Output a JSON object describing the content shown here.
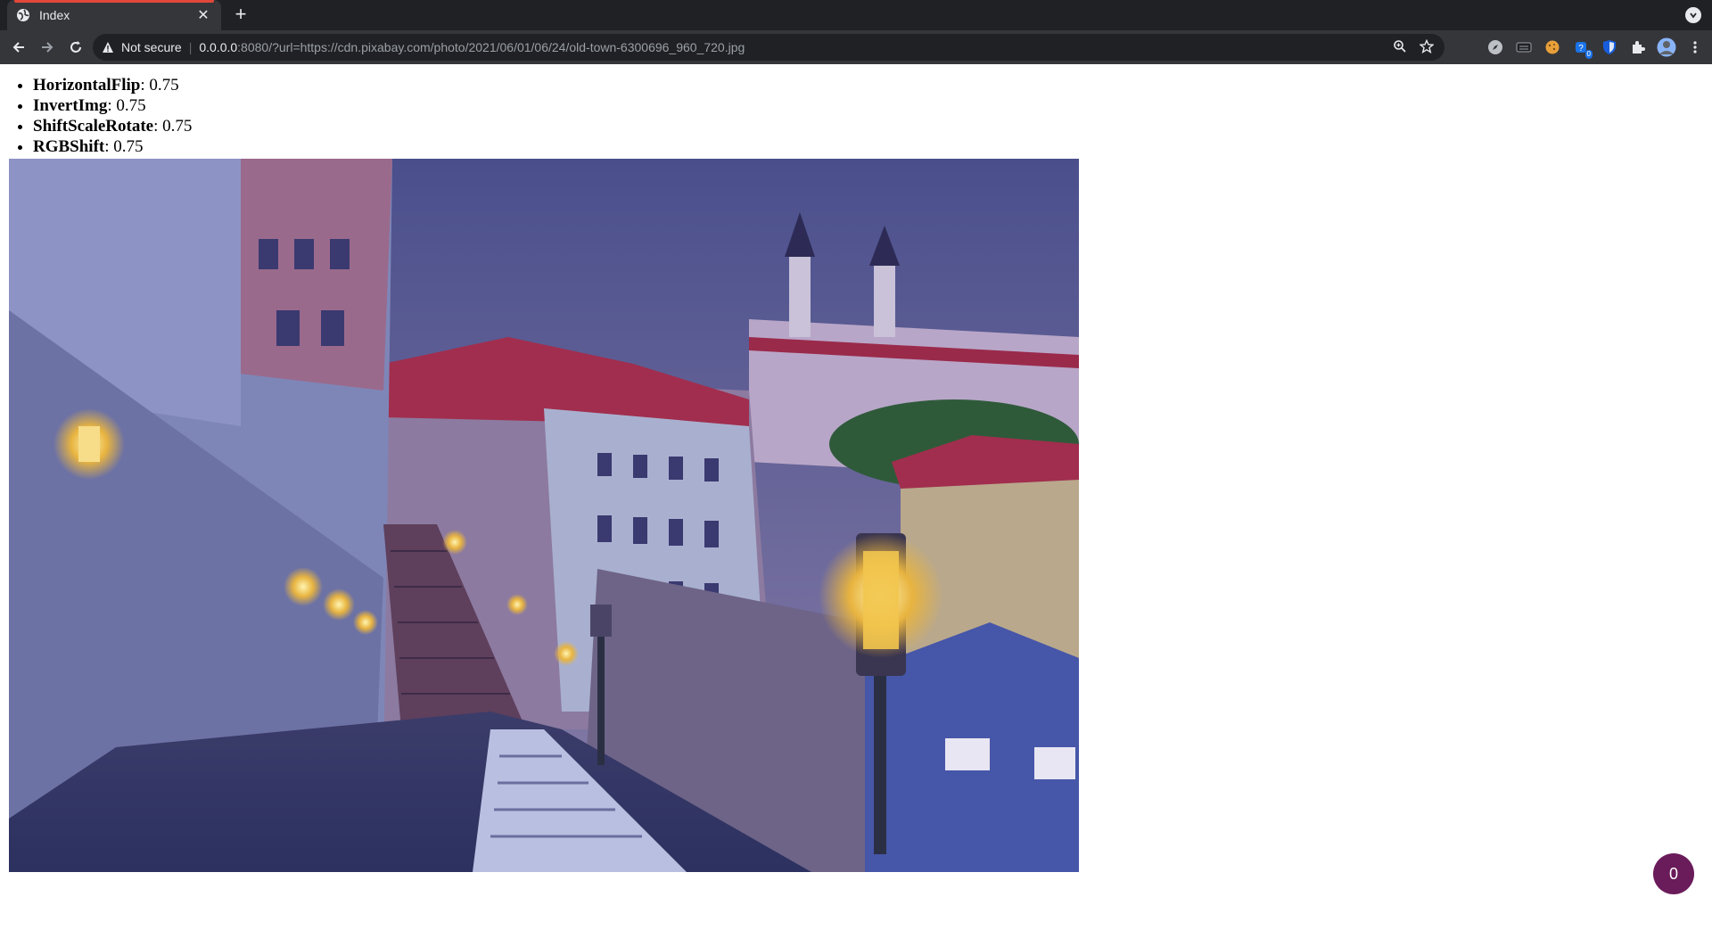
{
  "tab": {
    "title": "Index",
    "close_label": "✕"
  },
  "new_tab_label": "+",
  "omnibox": {
    "security_label": "Not secure",
    "url_host": "0.0.0.0",
    "url_rest": ":8080/?url=https://cdn.pixabay.com/photo/2021/06/01/06/24/old-town-6300696_960_720.jpg"
  },
  "extensions": {
    "notification_badge": "0"
  },
  "augmentations": [
    {
      "name": "HorizontalFlip",
      "value": ": 0.75"
    },
    {
      "name": "InvertImg",
      "value": ": 0.75"
    },
    {
      "name": "ShiftScaleRotate",
      "value": ": 0.75"
    },
    {
      "name": "RGBShift",
      "value": ": 0.75"
    }
  ],
  "fab": {
    "label": "0",
    "color": "#6a1b5a"
  }
}
